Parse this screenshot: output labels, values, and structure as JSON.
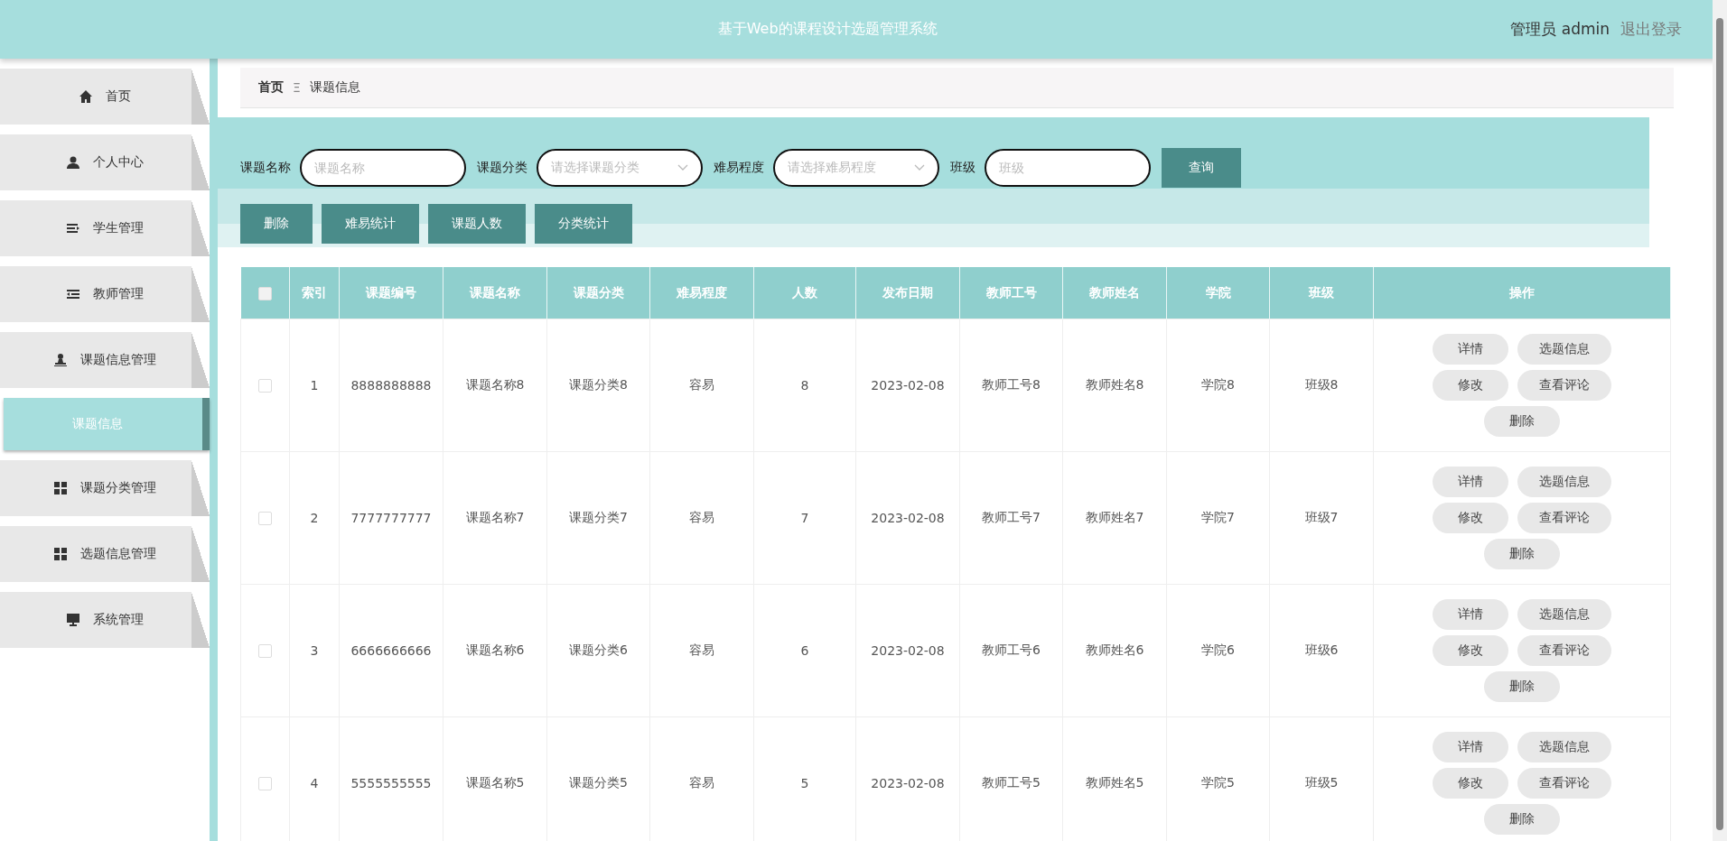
{
  "header": {
    "title": "基于Web的课程设计选题管理系统",
    "user": "管理员 admin",
    "logout": "退出登录"
  },
  "sidebar": {
    "items": [
      {
        "label": "首页",
        "selected": false
      },
      {
        "label": "个人中心",
        "selected": false
      },
      {
        "label": "学生管理",
        "selected": false
      },
      {
        "label": "教师管理",
        "selected": false
      },
      {
        "label": "课题信息管理",
        "selected": false,
        "children": [
          {
            "label": "课题信息",
            "selected": true
          }
        ]
      },
      {
        "label": "课题分类管理",
        "selected": false
      },
      {
        "label": "选题信息管理",
        "selected": false
      },
      {
        "label": "系统管理",
        "selected": false
      }
    ]
  },
  "breadcrumb": {
    "home": "首页",
    "separator": "Ξ",
    "current": "课题信息"
  },
  "search": {
    "fields": [
      {
        "kind": "input",
        "label": "课题名称",
        "placeholder": "课题名称"
      },
      {
        "kind": "select",
        "label": "课题分类",
        "placeholder": "请选择课题分类"
      },
      {
        "kind": "select",
        "label": "难易程度",
        "placeholder": "请选择难易程度"
      },
      {
        "kind": "input",
        "label": "班级",
        "placeholder": "班级"
      }
    ],
    "button": "查询"
  },
  "toolbar": [
    "删除",
    "难易统计",
    "课题人数",
    "分类统计"
  ],
  "table": {
    "select_all_checked": false,
    "columns": [
      "索引",
      "课题编号",
      "课题名称",
      "课题分类",
      "难易程度",
      "人数",
      "发布日期",
      "教师工号",
      "教师姓名",
      "学院",
      "班级",
      "操作"
    ],
    "rows": [
      {
        "checked": false,
        "cells": [
          "1",
          "8888888888",
          "课题名称8",
          "课题分类8",
          "容易",
          "8",
          "2023-02-08",
          "教师工号8",
          "教师姓名8",
          "学院8",
          "班级8"
        ],
        "actions": [
          "详情",
          "选题信息",
          "修改",
          "查看评论",
          "删除"
        ]
      },
      {
        "checked": false,
        "cells": [
          "2",
          "7777777777",
          "课题名称7",
          "课题分类7",
          "容易",
          "7",
          "2023-02-08",
          "教师工号7",
          "教师姓名7",
          "学院7",
          "班级7"
        ],
        "actions": [
          "详情",
          "选题信息",
          "修改",
          "查看评论",
          "删除"
        ]
      },
      {
        "checked": false,
        "cells": [
          "3",
          "6666666666",
          "课题名称6",
          "课题分类6",
          "容易",
          "6",
          "2023-02-08",
          "教师工号6",
          "教师姓名6",
          "学院6",
          "班级6"
        ],
        "actions": [
          "详情",
          "选题信息",
          "修改",
          "查看评论",
          "删除"
        ]
      },
      {
        "checked": false,
        "cells": [
          "4",
          "5555555555",
          "课题名称5",
          "课题分类5",
          "容易",
          "5",
          "2023-02-08",
          "教师工号5",
          "教师姓名5",
          "学院5",
          "班级5"
        ],
        "actions": [
          "详情",
          "选题信息",
          "修改",
          "查看评论",
          "删除"
        ]
      }
    ]
  }
}
